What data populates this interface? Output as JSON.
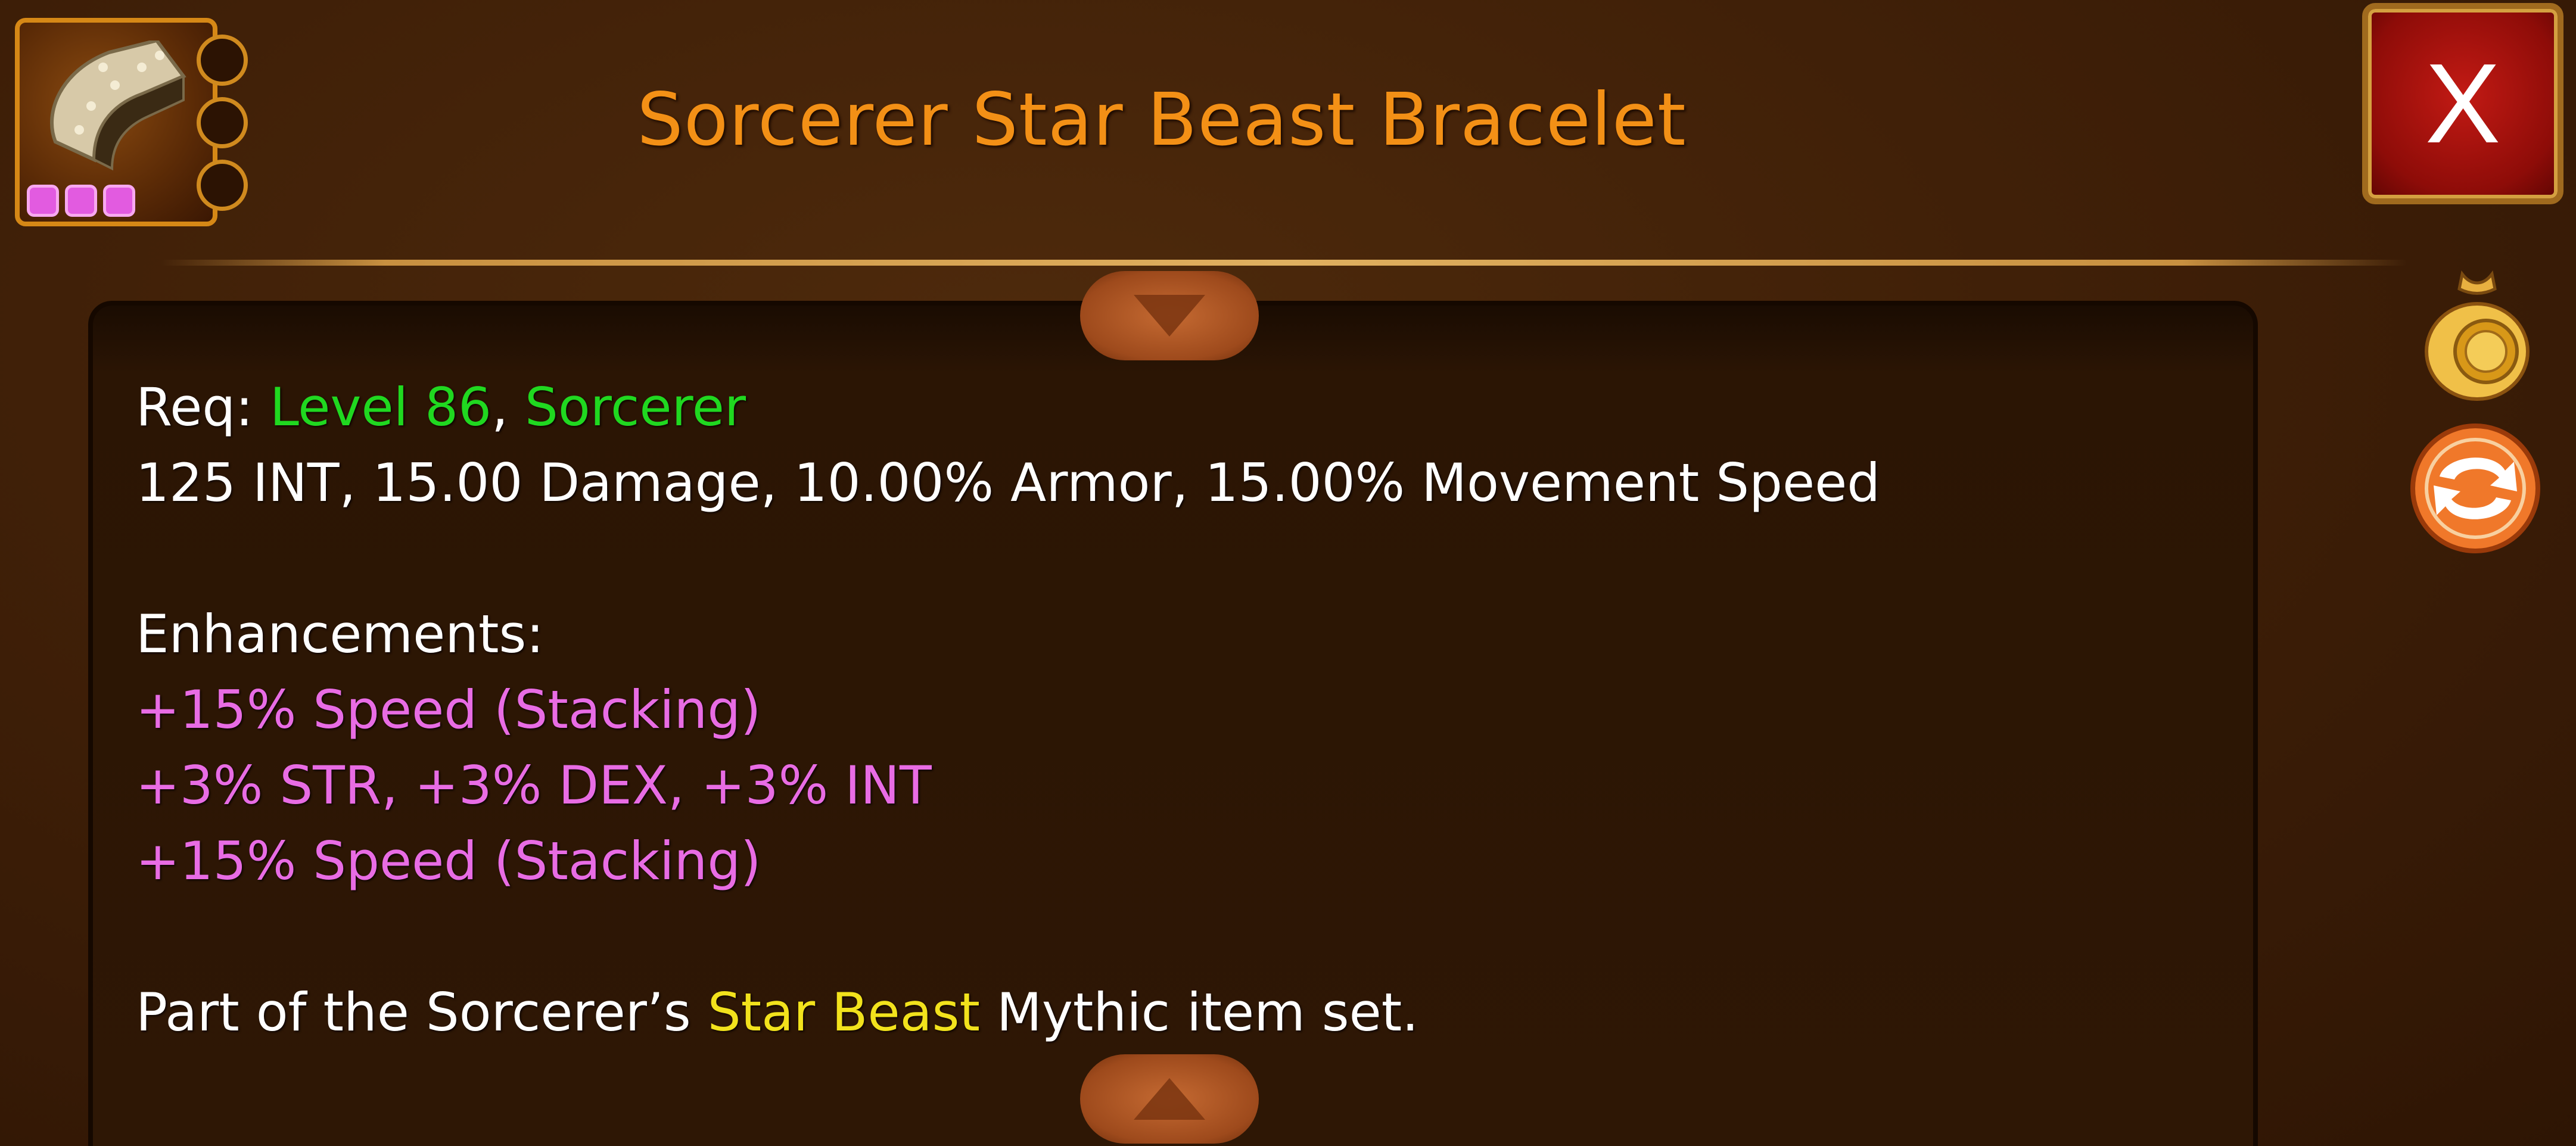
{
  "item": {
    "title": "Sorcerer Star Beast Bracelet",
    "icon": "bracelet-icon",
    "sockets": 3,
    "gems": 3
  },
  "close_button": {
    "label": "X"
  },
  "stats": {
    "req_label": "Req: ",
    "req_level": "Level 86",
    "req_separator": ", ",
    "req_class": "Sorcerer",
    "main_stats": "125 INT, 15.00 Damage, 10.00% Armor, 15.00% Movement Speed",
    "enhancements_label": "Enhancements:",
    "enhancements": [
      "+15% Speed (Stacking)",
      "+3% STR, +3% DEX, +3% INT",
      "+15% Speed (Stacking)"
    ],
    "set_prefix": "Part of the Sorcerer’s ",
    "set_name": "Star Beast",
    "set_suffix": " Mythic item set."
  },
  "side_actions": [
    {
      "name": "sell",
      "icon": "coin-bag-icon"
    },
    {
      "name": "swap",
      "icon": "swap-arrows-icon"
    }
  ],
  "colors": {
    "title": "#f39016",
    "requirement": "#20d820",
    "enhancement": "#e86ce4",
    "set_name": "#f2e21c",
    "close_button": "#c21a14"
  }
}
